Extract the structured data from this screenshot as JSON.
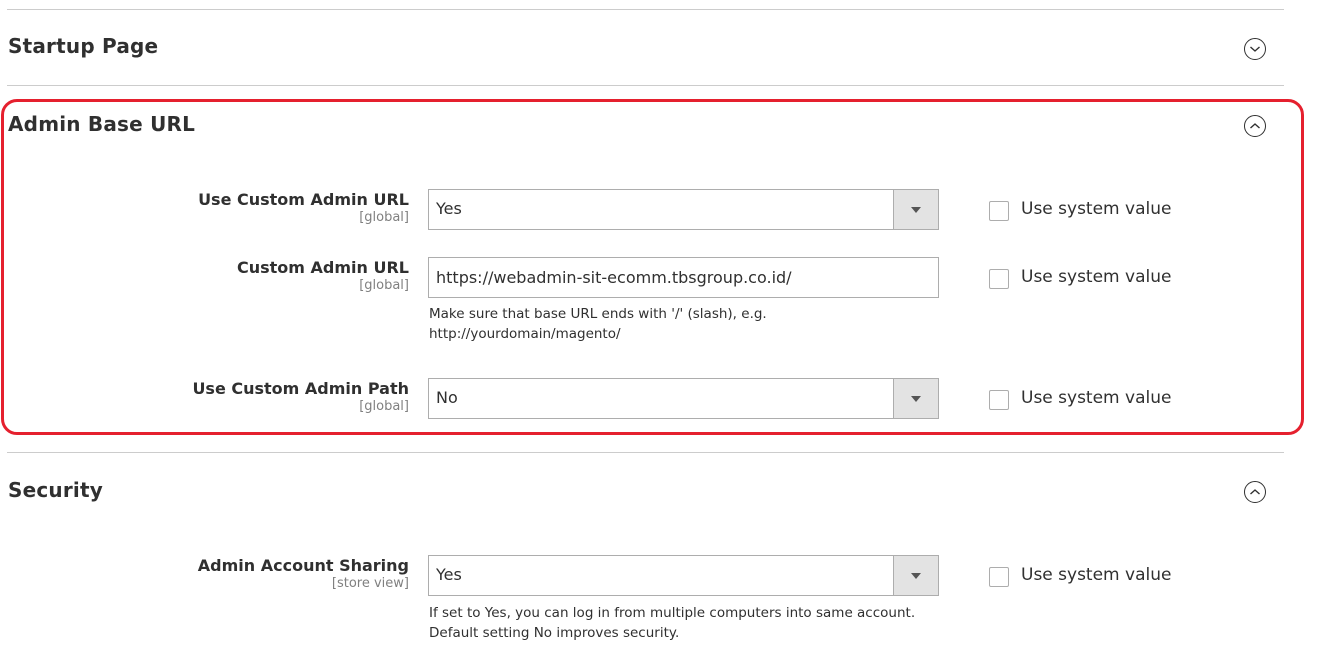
{
  "colors": {
    "highlight": "#e5202e",
    "text": "#303030",
    "muted": "#808080",
    "border": "#adadad",
    "divider": "#cccccc",
    "select_arrow_bg": "#e3e3e3"
  },
  "sections": {
    "startup_page": {
      "title": "Startup Page",
      "toggle_icon": "chevron-down-circle-icon",
      "expanded": false
    },
    "admin_base_url": {
      "title": "Admin Base URL",
      "toggle_icon": "chevron-up-circle-icon",
      "expanded": true,
      "highlighted": true,
      "fields": [
        {
          "label": "Use Custom Admin URL",
          "scope": "[global]",
          "type": "select",
          "value": "Yes",
          "use_system_value_label": "Use system value",
          "use_system_value_checked": false
        },
        {
          "label": "Custom Admin URL",
          "scope": "[global]",
          "type": "text",
          "value": "https://webadmin-sit-ecomm.tbsgroup.co.id/",
          "note_line1": "Make sure that base URL ends with '/' (slash), e.g.",
          "note_line2": "http://yourdomain/magento/",
          "use_system_value_label": "Use system value",
          "use_system_value_checked": false
        },
        {
          "label": "Use Custom Admin Path",
          "scope": "[global]",
          "type": "select",
          "value": "No",
          "use_system_value_label": "Use system value",
          "use_system_value_checked": false
        }
      ]
    },
    "security": {
      "title": "Security",
      "toggle_icon": "chevron-up-circle-icon",
      "expanded": true,
      "fields": [
        {
          "label": "Admin Account Sharing",
          "scope": "[store view]",
          "type": "select",
          "value": "Yes",
          "note_line1": "If set to Yes, you can log in from multiple computers into same account.",
          "note_line2": "Default setting No improves security.",
          "use_system_value_label": "Use system value",
          "use_system_value_checked": false
        }
      ]
    }
  }
}
